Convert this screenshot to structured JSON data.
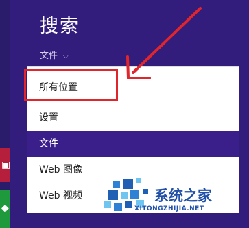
{
  "search_panel": {
    "title": "搜索",
    "scope_selector": {
      "value": "文件"
    }
  },
  "menu": {
    "items": [
      {
        "label": "所有位置",
        "selected": false
      },
      {
        "label": "设置",
        "selected": false
      },
      {
        "label": "文件",
        "selected": true
      },
      {
        "label": "Web 图像",
        "selected": false
      },
      {
        "label": "Web 视频",
        "selected": false
      }
    ]
  },
  "annotation": {
    "color": "#e0252c"
  },
  "watermark": {
    "brand": "系统之家",
    "url": "XITONGZHIJIA.NET"
  },
  "colors": {
    "background": "#321c7c",
    "selected": "#3a1e8a",
    "accent_red": "#b51f3c",
    "accent_green": "#1e9a3c"
  }
}
